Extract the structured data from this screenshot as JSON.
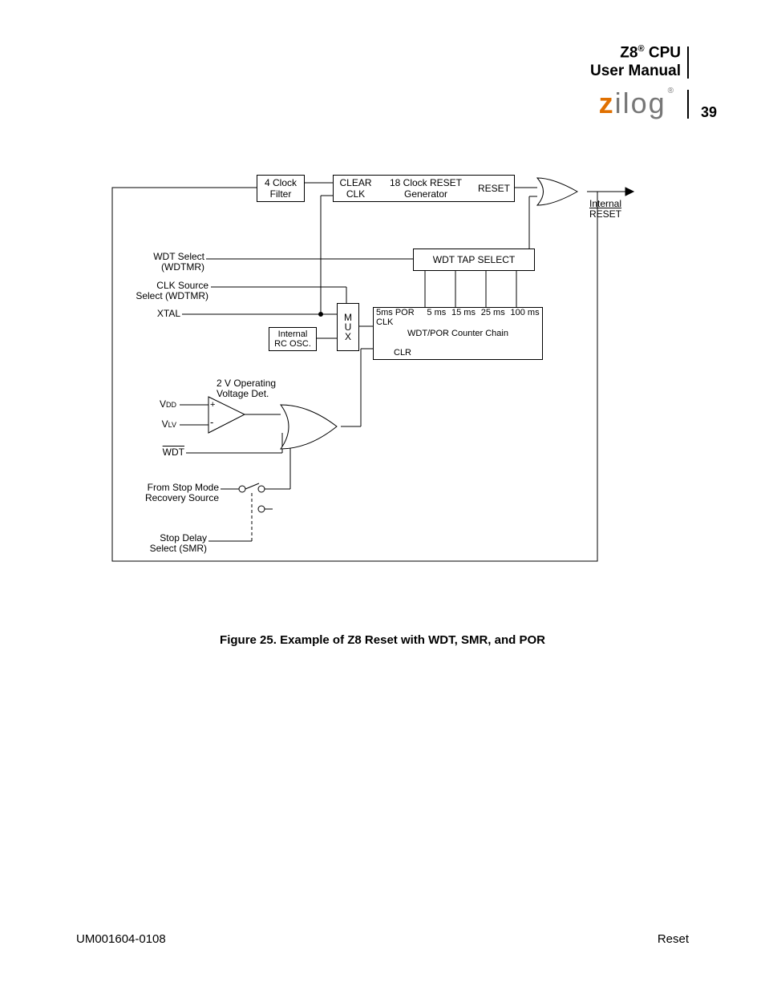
{
  "header": {
    "product": "Z8",
    "reg": "®",
    "cpu": "CPU",
    "manual": "User Manual"
  },
  "logo": {
    "z": "z",
    "rest": "ilog",
    "reg": "®"
  },
  "page_number": "39",
  "diagram": {
    "clock_filter": {
      "l1": "4 Clock",
      "l2": "Filter"
    },
    "reset_gen": {
      "clear": "CLEAR",
      "clk": "CLK",
      "title": "18 Clock RESET",
      "gen": "Generator",
      "reset_pin": "RESET"
    },
    "out": {
      "l1": "Internal",
      "l2": "RESET"
    },
    "wdt_select": {
      "l1": "WDT Select",
      "l2": "(WDTMR)"
    },
    "clk_source": {
      "l1": "CLK Source",
      "l2": "Select (WDTMR)"
    },
    "xtal": "XTAL",
    "rc_osc": {
      "l1": "Internal",
      "l2": "RC OSC."
    },
    "mux": "M\nU\nX",
    "tap_select": "WDT   TAP   SELECT",
    "counter": {
      "t5por": "5ms  POR",
      "clk": "CLK",
      "clr": "CLR",
      "t5": "5 ms",
      "t15": "15 ms",
      "t25": "25 ms",
      "t100": "100 ms",
      "title": "WDT/POR Counter Chain"
    },
    "volt_det": {
      "l1": "2 V Operating",
      "l2": "Voltage Det."
    },
    "vdd": {
      "main": "V",
      "sub": "DD"
    },
    "vlv": {
      "main": "V",
      "sub": "LV"
    },
    "wdt": "WDT",
    "stop_mode": {
      "l1": "From Stop Mode",
      "l2": "Recovery Source"
    },
    "stop_delay": {
      "l1": "Stop Delay",
      "l2": "Select (SMR)"
    },
    "plus": "+",
    "minus": "-"
  },
  "caption": "Figure 25. Example of Z8 Reset with WDT, SMR, and POR",
  "footer": {
    "left": "UM001604-0108",
    "right": "Reset"
  }
}
